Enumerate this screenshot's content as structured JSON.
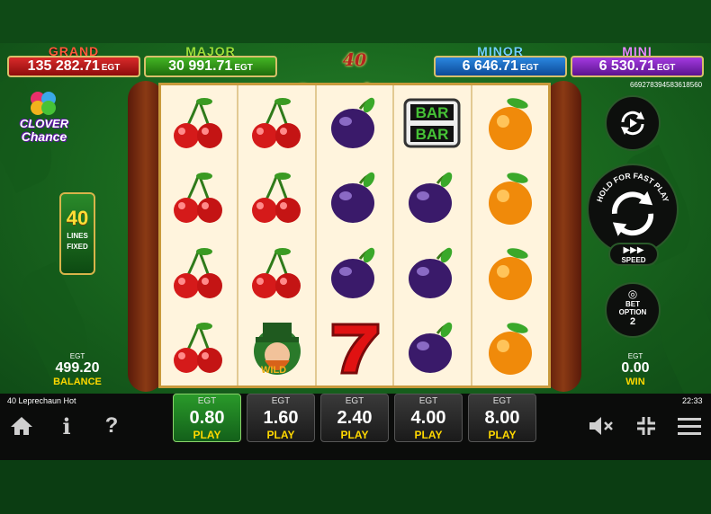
{
  "jackpots": [
    {
      "name": "GRAND",
      "value": "135 282.71",
      "currency": "EGT"
    },
    {
      "name": "MAJOR",
      "value": "30 991.71",
      "currency": "EGT"
    },
    {
      "name": "MINOR",
      "value": "6 646.71",
      "currency": "EGT"
    },
    {
      "name": "MINI",
      "value": "6 530.71",
      "currency": "EGT"
    }
  ],
  "logo": {
    "title": "40 Leprechaun Hot"
  },
  "ticket_id": "669278394583618560",
  "clover_chance": {
    "line1": "CLOVER",
    "line2": "Chance"
  },
  "lines": {
    "count": "40",
    "line1": "LINES",
    "line2": "FIXED"
  },
  "reels": [
    [
      "cherry",
      "cherry",
      "cherry",
      "cherry"
    ],
    [
      "cherry",
      "cherry",
      "cherry",
      "leprechaun-wild"
    ],
    [
      "plum",
      "plum",
      "plum",
      "seven"
    ],
    [
      "bar-bar",
      "plum",
      "plum",
      "plum"
    ],
    [
      "orange",
      "orange",
      "orange",
      "orange"
    ]
  ],
  "balance": {
    "currency": "EGT",
    "value": "499.20",
    "label": "BALANCE"
  },
  "win": {
    "currency": "EGT",
    "value": "0.00",
    "label": "WIN"
  },
  "spin": {
    "hold_text": "HOLD FOR FAST PLAY",
    "speed_label": "SPEED"
  },
  "bet_option": {
    "line1": "BET",
    "line2": "OPTION",
    "value": "2"
  },
  "footer": {
    "game_name": "40 Leprechaun Hot",
    "clock": "22:33"
  },
  "bets": [
    {
      "currency": "EGT",
      "value": "0.80",
      "label": "PLAY",
      "active": true
    },
    {
      "currency": "EGT",
      "value": "1.60",
      "label": "PLAY",
      "active": false
    },
    {
      "currency": "EGT",
      "value": "2.40",
      "label": "PLAY",
      "active": false
    },
    {
      "currency": "EGT",
      "value": "4.00",
      "label": "PLAY",
      "active": false
    },
    {
      "currency": "EGT",
      "value": "8.00",
      "label": "PLAY",
      "active": false
    }
  ],
  "colors": {
    "grand": "#d92a2a",
    "major": "#43b524",
    "minor": "#2a86e0",
    "mini": "#a43ae0",
    "play": "#ffd800"
  }
}
